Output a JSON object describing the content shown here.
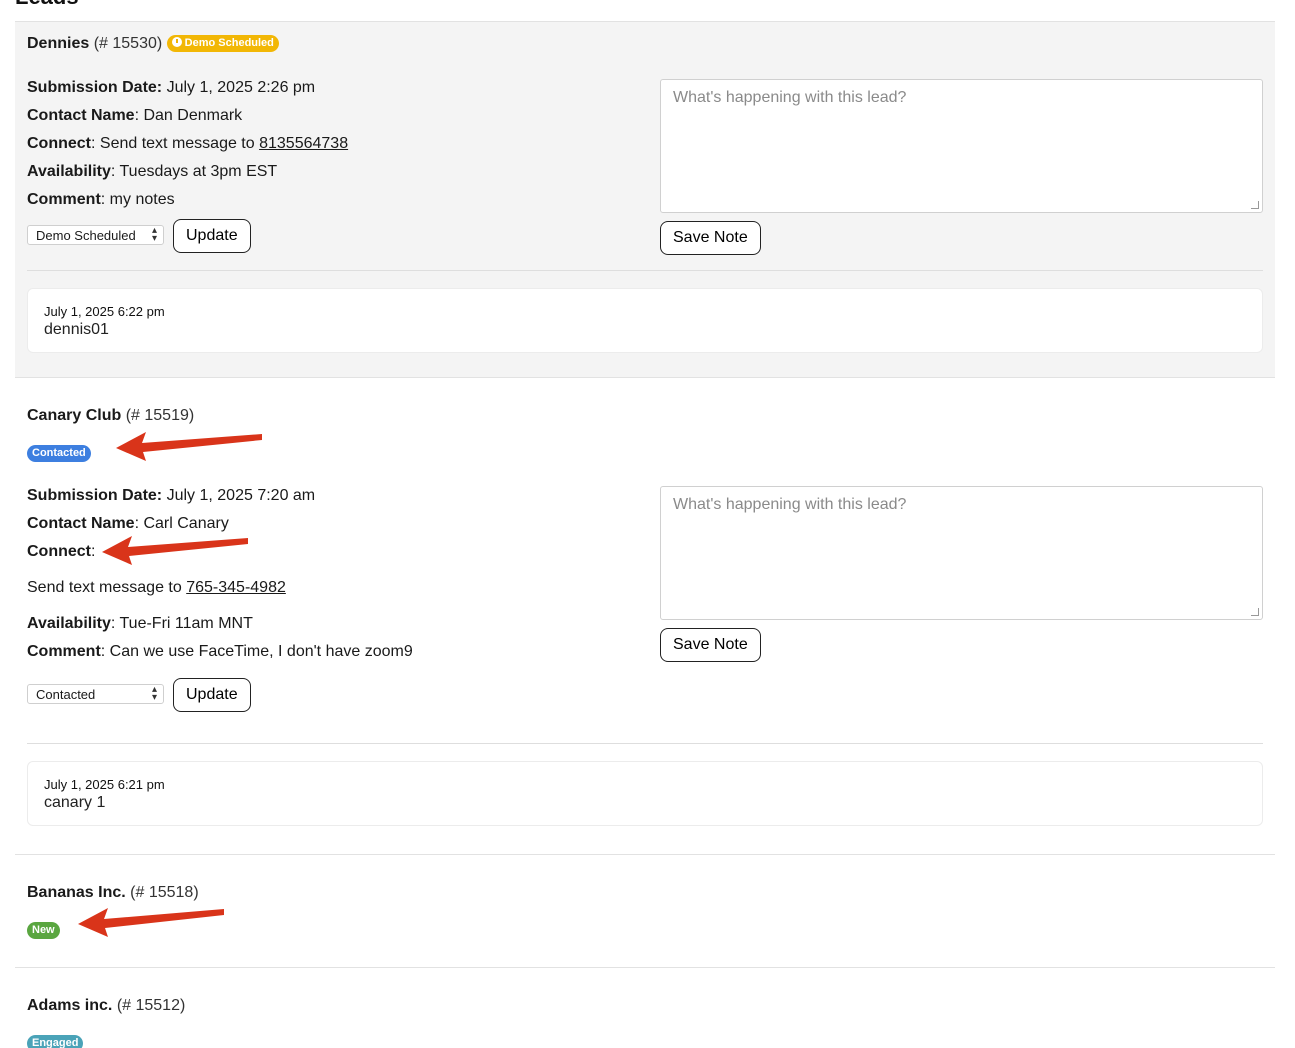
{
  "page": {
    "title": "Leads"
  },
  "colors": {
    "demo_scheduled": "#f2b705",
    "contacted": "#3d7fe0",
    "new": "#5aa640",
    "engaged": "#4aa3b8",
    "annotation_arrow": "#d9341a"
  },
  "note_placeholder": "What's happening with this lead?",
  "save_note_label": "Save Note",
  "update_label": "Update",
  "labels": {
    "submission_date": "Submission Date:",
    "contact_name": "Contact Name",
    "connect": "Connect",
    "availability": "Availability",
    "comment": "Comment"
  },
  "leads": [
    {
      "name": "Dennies",
      "number": "(# 15530)",
      "status": "Demo Scheduled",
      "submission_date": "July 1, 2025 2:26 pm",
      "contact_name": "Dan Denmark",
      "connect_text": "Send text message to",
      "phone": "8135564738",
      "availability": "Tuesdays at 3pm EST",
      "comment": "my notes",
      "selected_status": "Demo Scheduled",
      "notes": [
        {
          "timestamp": "July 1, 2025 6:22 pm",
          "text": "dennis01"
        }
      ]
    },
    {
      "name": "Canary Club",
      "number": "(# 15519)",
      "status": "Contacted",
      "submission_date": "July 1, 2025 7:20 am",
      "contact_name": "Carl Canary",
      "connect_text": "Send text message to",
      "phone": "765-345-4982",
      "availability": "Tue-Fri 11am MNT",
      "comment": "Can we use FaceTime, I don't have zoom9",
      "selected_status": "Contacted",
      "notes": [
        {
          "timestamp": "July 1, 2025 6:21 pm",
          "text": "canary 1"
        }
      ]
    },
    {
      "name": "Bananas Inc.",
      "number": "(# 15518)",
      "status": "New"
    },
    {
      "name": "Adams inc.",
      "number": "(# 15512)",
      "status": "Engaged"
    }
  ]
}
